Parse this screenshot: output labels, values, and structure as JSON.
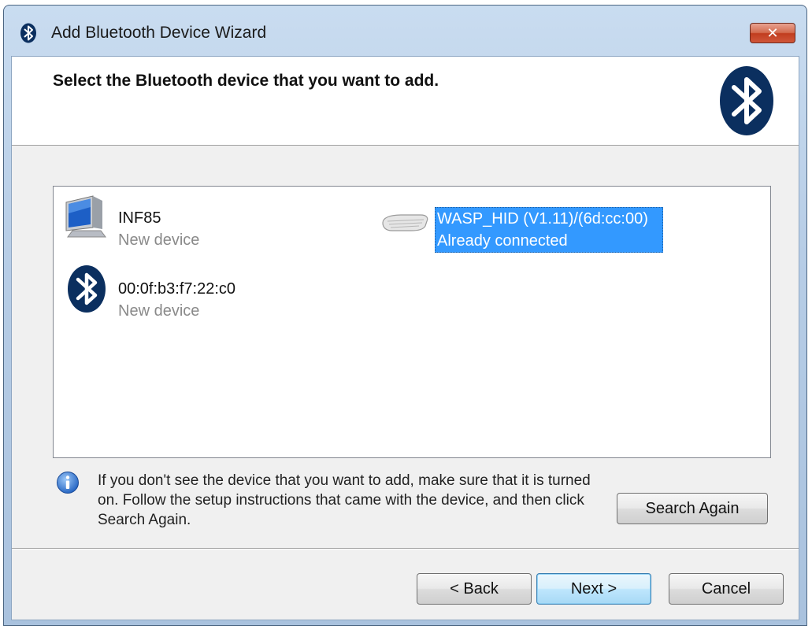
{
  "window": {
    "title": "Add Bluetooth Device Wizard",
    "close_label": "✕"
  },
  "header": {
    "heading": "Select the Bluetooth device that you want to add."
  },
  "devices": [
    {
      "name": "INF85",
      "status": "New device",
      "icon": "computer-icon",
      "selected": false
    },
    {
      "name": "WASP_HID (V1.11)/(6d:cc:00)",
      "status": "Already connected",
      "icon": "keyboard-icon",
      "selected": true
    },
    {
      "name": "00:0f:b3:f7:22:c0",
      "status": "New device",
      "icon": "bluetooth-icon",
      "selected": false
    }
  ],
  "info": {
    "icon": "info-icon",
    "text": "If you don't see the device that you want to add, make sure that it is turned on. Follow the setup instructions that came with the device, and then click Search Again."
  },
  "buttons": {
    "search_again": "Search Again",
    "back": "< Back",
    "next": "Next >",
    "cancel": "Cancel"
  },
  "colors": {
    "selection": "#3399ff",
    "bluetooth_blue": "#0b2f5f"
  }
}
